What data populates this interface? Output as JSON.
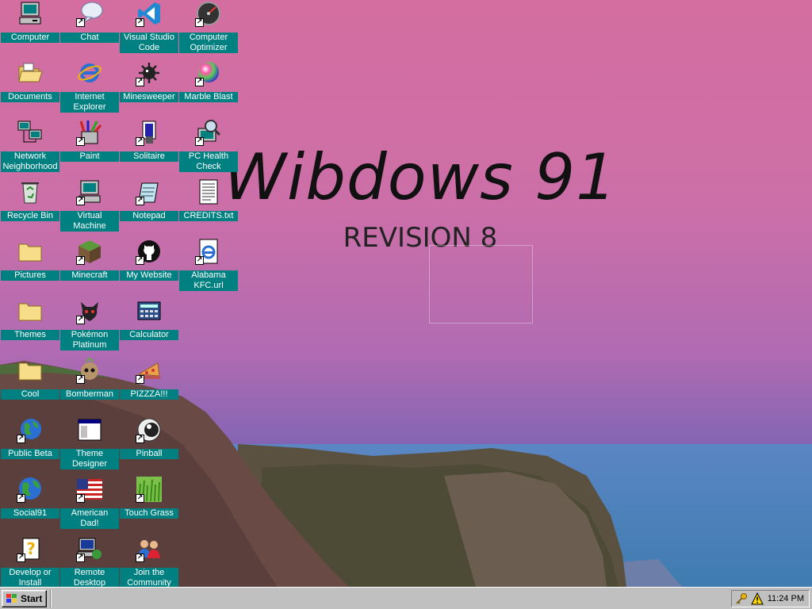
{
  "desktop": {
    "title": "Wibdows 91",
    "subtitle": "REVISION 8",
    "icons": [
      {
        "label": "Computer"
      },
      {
        "label": "Chat"
      },
      {
        "label": "Visual Studio Code"
      },
      {
        "label": "Computer Optimizer"
      },
      {
        "label": "Documents"
      },
      {
        "label": "Internet Explorer"
      },
      {
        "label": "Minesweeper"
      },
      {
        "label": "Marble Blast"
      },
      {
        "label": "Network Neighborhood"
      },
      {
        "label": "Paint"
      },
      {
        "label": "Solitaire"
      },
      {
        "label": "PC Health Check"
      },
      {
        "label": "Recycle Bin"
      },
      {
        "label": "Virtual Machine"
      },
      {
        "label": "Notepad"
      },
      {
        "label": "CREDITS.txt"
      },
      {
        "label": "Pictures"
      },
      {
        "label": "Minecraft"
      },
      {
        "label": "My Website"
      },
      {
        "label": "Alabama KFC.url"
      },
      {
        "label": "Themes"
      },
      {
        "label": "Pokémon Platinum"
      },
      {
        "label": "Calculator"
      },
      {
        "label": "Cool"
      },
      {
        "label": "Bomberman"
      },
      {
        "label": "PIZZZA!!!"
      },
      {
        "label": "Public Beta"
      },
      {
        "label": "Theme Designer"
      },
      {
        "label": "Pinball"
      },
      {
        "label": "Social91"
      },
      {
        "label": "American Dad!"
      },
      {
        "label": "Touch Grass"
      },
      {
        "label": "Develop or Install"
      },
      {
        "label": "Remote Desktop"
      },
      {
        "label": "Join the Community"
      }
    ]
  },
  "taskbar": {
    "start_label": "Start",
    "clock": "11:24 PM",
    "tray_icons": [
      "key-icon",
      "warning-icon"
    ]
  },
  "colors": {
    "icon_label_bg": "#008080",
    "taskbar": "#c0c0c0"
  }
}
